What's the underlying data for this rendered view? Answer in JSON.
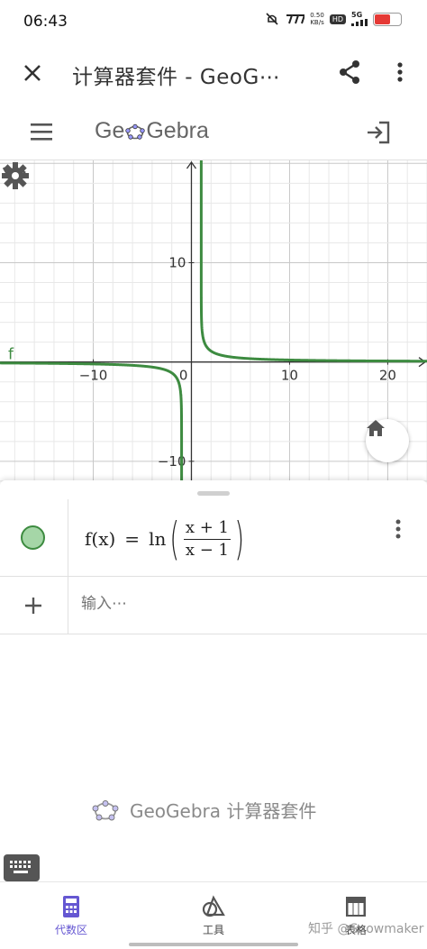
{
  "status_bar": {
    "time": "06:43",
    "net_speed_value": "0.50",
    "net_speed_unit": "KB/s",
    "hd": "HD",
    "signal_type": "5G",
    "battery_level": 0.6
  },
  "app_bar": {
    "title": "计算器套件 - GeoG⋯",
    "close_icon": "close-icon",
    "share_icon": "share-icon",
    "menu_icon": "more-vertical-icon"
  },
  "geogebra_header": {
    "logo_text_start": "Ge",
    "logo_text_end": "Gebra",
    "menu_icon": "hamburger-icon",
    "login_icon": "sign-in-icon"
  },
  "chart_data": {
    "type": "line",
    "function_label": "f",
    "expression": "ln((x+1)/(x-1))",
    "xlim": [
      -19.5,
      24.0
    ],
    "ylim": [
      -12.1,
      20.3
    ],
    "x_ticks": [
      -10,
      0,
      10,
      20
    ],
    "x_tick_labels": [
      "−10",
      "0",
      "10",
      "20"
    ],
    "y_ticks": [
      -10,
      10
    ],
    "y_tick_labels": [
      "−10",
      "10"
    ],
    "grid": true,
    "line_color": "#3d8b40",
    "series": [
      {
        "domain": [
          -19.5,
          -1.0
        ]
      },
      {
        "domain": [
          1.0,
          24.0
        ]
      }
    ]
  },
  "graphics_tools": {
    "undo_icon": "undo-icon",
    "settings_icon": "gear-icon",
    "home_icon": "home-icon"
  },
  "algebra": {
    "item1": {
      "lhs": "f(x)",
      "equals": "=",
      "fn": "ln",
      "numerator": "x + 1",
      "denominator": "x − 1",
      "color": "#3d8b40"
    },
    "input_placeholder": "输入⋯",
    "suite_brand": "GeoGebra 计算器套件"
  },
  "bottom_nav": {
    "items": [
      {
        "label": "代数区",
        "icon": "calculator-icon",
        "active": true
      },
      {
        "label": "工具",
        "icon": "tools-icon",
        "active": false
      },
      {
        "label": "表格",
        "icon": "table-icon",
        "active": false
      }
    ]
  },
  "watermark": "知乎 @Snowmaker"
}
